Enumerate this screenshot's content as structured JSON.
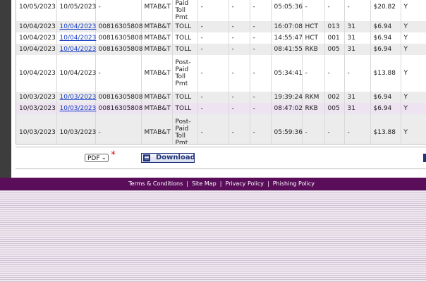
{
  "rows": [
    {
      "posting_date": "10/05/2023",
      "transaction_date": "10/05/2023",
      "tag": "-",
      "agency": "MTAB&T",
      "description": "Post-Paid Toll Pmt",
      "c1": "-",
      "c2": "-",
      "c3": "-",
      "time": "05:05:36",
      "plaza": "-",
      "lane": "-",
      "cls": "-",
      "amount": "$20.82",
      "flag": "Y",
      "link": false,
      "style": "white"
    },
    {
      "posting_date": "10/04/2023",
      "transaction_date": "10/04/2023",
      "tag": "00816305808",
      "agency": "MTAB&T",
      "description": "TOLL",
      "c1": "-",
      "c2": "-",
      "c3": "-",
      "time": "16:07:08",
      "plaza": "HCT",
      "lane": "013",
      "cls": "31",
      "amount": "$6.94",
      "flag": "Y",
      "link": true,
      "style": "band"
    },
    {
      "posting_date": "10/04/2023",
      "transaction_date": "10/04/2023",
      "tag": "00816305808",
      "agency": "MTAB&T",
      "description": "TOLL",
      "c1": "-",
      "c2": "-",
      "c3": "-",
      "time": "14:55:47",
      "plaza": "HCT",
      "lane": "001",
      "cls": "31",
      "amount": "$6.94",
      "flag": "Y",
      "link": true,
      "style": "white"
    },
    {
      "posting_date": "10/04/2023",
      "transaction_date": "10/04/2023",
      "tag": "00816305808",
      "agency": "MTAB&T",
      "description": "TOLL",
      "c1": "-",
      "c2": "-",
      "c3": "-",
      "time": "08:41:55",
      "plaza": "RKB",
      "lane": "005",
      "cls": "31",
      "amount": "$6.94",
      "flag": "Y",
      "link": true,
      "style": "band"
    },
    {
      "posting_date": "10/04/2023",
      "transaction_date": "10/04/2023",
      "tag": "-",
      "agency": "MTAB&T",
      "description": "Post-Paid Toll Pmt",
      "c1": "-",
      "c2": "-",
      "c3": "-",
      "time": "05:34:41",
      "plaza": "-",
      "lane": "-",
      "cls": "-",
      "amount": "$13.88",
      "flag": "Y",
      "link": false,
      "style": "white"
    },
    {
      "posting_date": "10/03/2023",
      "transaction_date": "10/03/2023",
      "tag": "00816305808",
      "agency": "MTAB&T",
      "description": "TOLL",
      "c1": "-",
      "c2": "-",
      "c3": "-",
      "time": "19:39:24",
      "plaza": "RKM",
      "lane": "002",
      "cls": "31",
      "amount": "$6.94",
      "flag": "Y",
      "link": true,
      "style": "band"
    },
    {
      "posting_date": "10/03/2023",
      "transaction_date": "10/03/2023",
      "tag": "00816305808",
      "agency": "MTAB&T",
      "description": "TOLL",
      "c1": "-",
      "c2": "-",
      "c3": "-",
      "time": "08:47:02",
      "plaza": "RKB",
      "lane": "005",
      "cls": "31",
      "amount": "$6.94",
      "flag": "Y",
      "link": true,
      "style": "hl"
    },
    {
      "posting_date": "10/03/2023",
      "transaction_date": "10/03/2023",
      "tag": "-",
      "agency": "MTAB&T",
      "description": "Post-Paid Toll Pmt",
      "c1": "-",
      "c2": "-",
      "c3": "-",
      "time": "05:59:36",
      "plaza": "-",
      "lane": "-",
      "cls": "-",
      "amount": "$13.88",
      "flag": "Y",
      "link": false,
      "style": "band"
    }
  ],
  "download": {
    "format_selected": "PDF",
    "required_mark": "*",
    "button_label": "Download"
  },
  "footer": {
    "links": [
      "Terms & Conditions",
      "Site Map",
      "Privacy Policy",
      "Phishing Policy"
    ],
    "separator": "|"
  },
  "colors": {
    "footer_bar": "#5a0e5a",
    "link": "#1a40c4",
    "highlight_row": "#ede3f1"
  }
}
